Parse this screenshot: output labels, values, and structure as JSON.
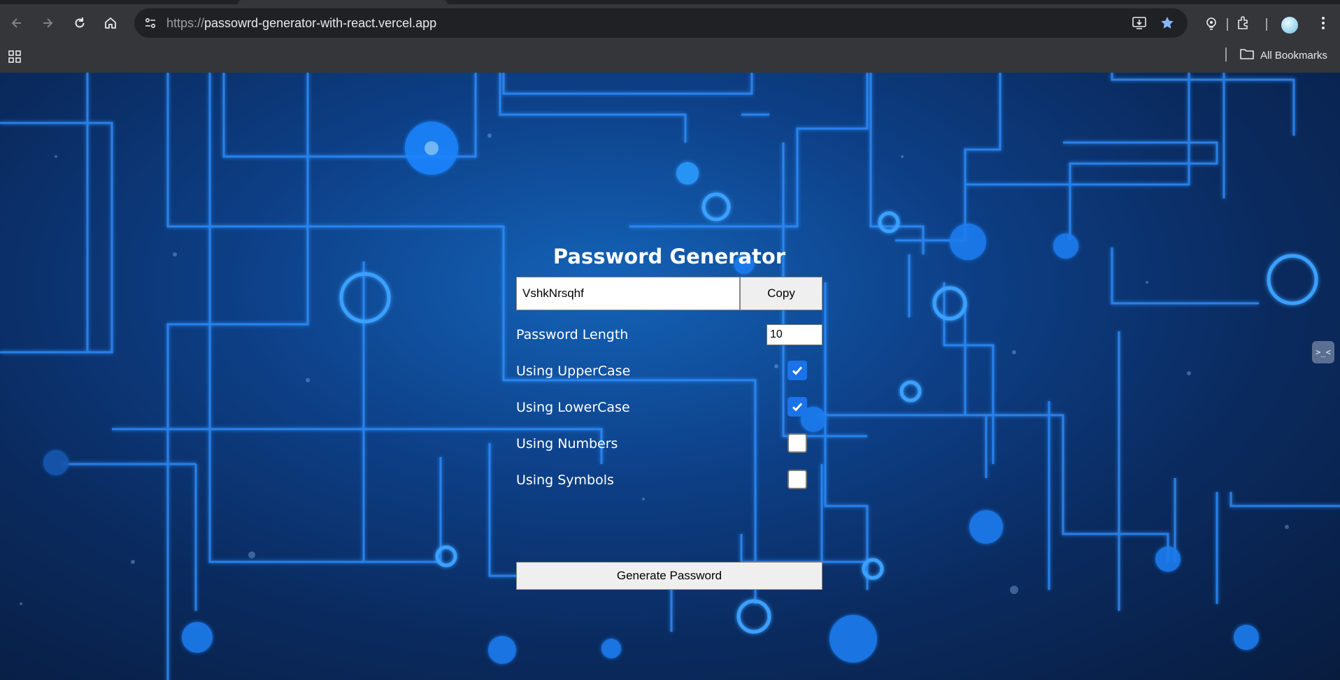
{
  "browser": {
    "url_protocol": "https://",
    "url_host": "passowrd-generator-with-react.vercel.app",
    "bookmarks_label": "All Bookmarks",
    "icons": [
      "back-icon",
      "forward-icon",
      "reload-icon",
      "home-icon",
      "site-info-icon",
      "install-app-icon",
      "bookmark-star-icon",
      "lens-icon",
      "extensions-icon",
      "profile-avatar",
      "menu-icon",
      "apps-grid-icon",
      "folder-icon"
    ]
  },
  "app": {
    "title": "Password Generator",
    "password_value": "VshkNrsqhf",
    "copy_label": "Copy",
    "length_label": "Password Length",
    "length_value": "10",
    "options": [
      {
        "label": "Using UpperCase",
        "checked": true
      },
      {
        "label": "Using LowerCase",
        "checked": true
      },
      {
        "label": "Using Numbers",
        "checked": false
      },
      {
        "label": "Using Symbols",
        "checked": false
      }
    ],
    "generate_label": "Generate Password"
  },
  "colors": {
    "checkbox_checked": "#1a73e8",
    "chrome_bg": "#35363a",
    "omnibox_bg": "#202124",
    "page_bg": "#0d3f86",
    "circuit_line": "#2f8fff"
  },
  "side_widget": ">_<"
}
